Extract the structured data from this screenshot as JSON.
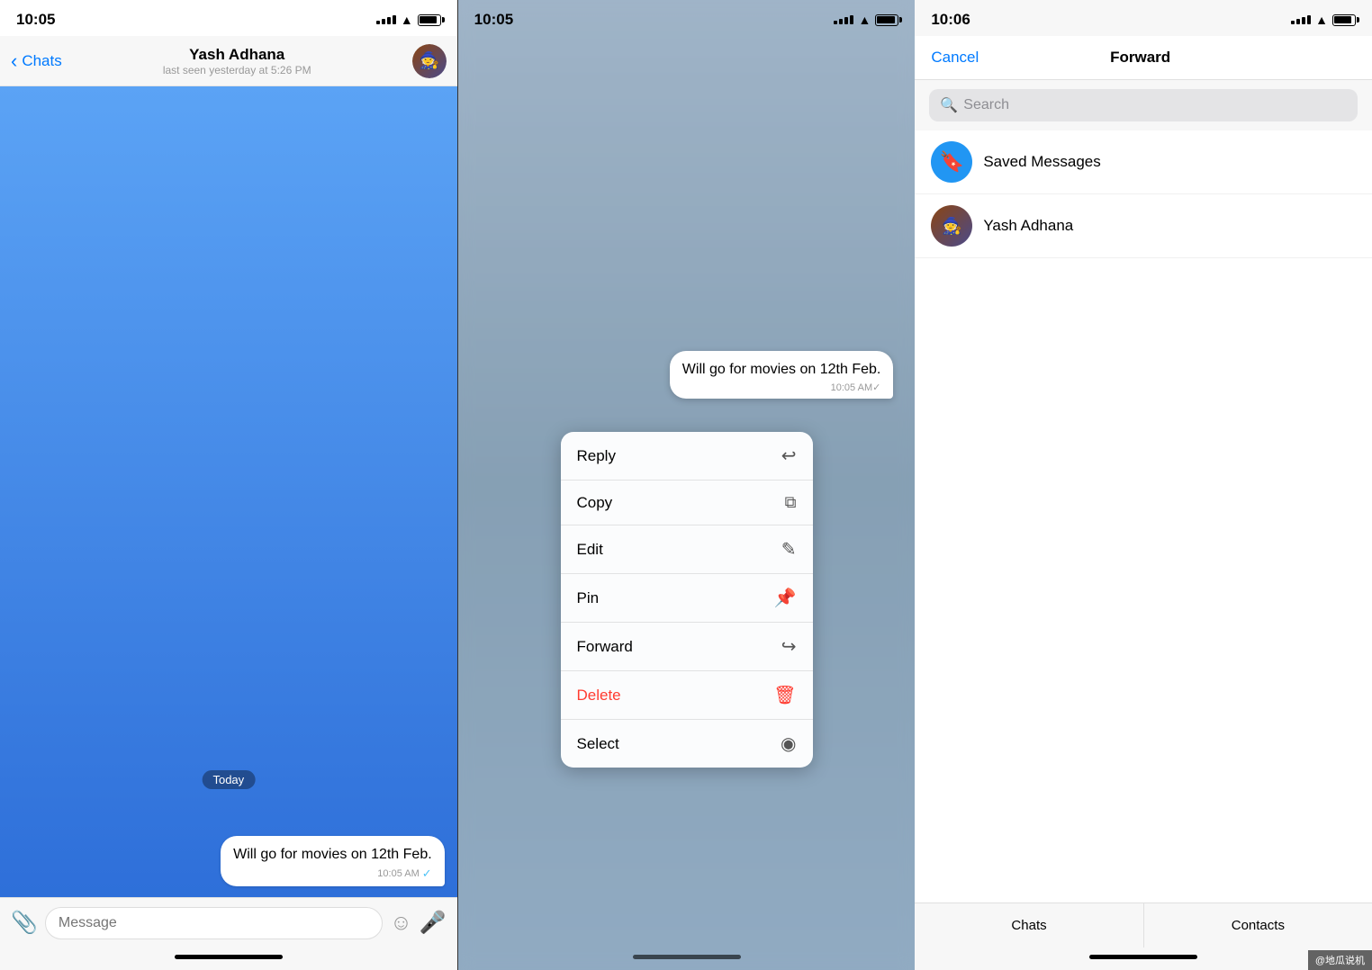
{
  "panel1": {
    "status": {
      "time": "10:05"
    },
    "header": {
      "back_label": "Chats",
      "title": "Yash Adhana",
      "subtitle": "last seen yesterday at 5:26 PM"
    },
    "today_label": "Today",
    "message": {
      "text": "Will go for movies on 12th Feb.",
      "time": "10:05 AM",
      "check": "✓"
    },
    "input": {
      "placeholder": "Message"
    }
  },
  "panel2": {
    "status": {
      "time": "10:05"
    },
    "message": {
      "text": "Will go for movies on 12th Feb.",
      "time": "10:05 AM✓"
    },
    "context_menu": {
      "items": [
        {
          "label": "Reply",
          "icon": "↩",
          "color": "normal"
        },
        {
          "label": "Copy",
          "icon": "⧉",
          "color": "normal"
        },
        {
          "label": "Edit",
          "icon": "✎",
          "color": "normal"
        },
        {
          "label": "Pin",
          "icon": "📌",
          "color": "normal"
        },
        {
          "label": "Forward",
          "icon": "↪",
          "color": "normal"
        },
        {
          "label": "Delete",
          "icon": "🗑",
          "color": "red"
        },
        {
          "label": "Select",
          "icon": "◉",
          "color": "normal"
        }
      ]
    }
  },
  "panel3": {
    "status": {
      "time": "10:06"
    },
    "header": {
      "cancel_label": "Cancel",
      "title": "Forward"
    },
    "search": {
      "placeholder": "Search"
    },
    "contacts": [
      {
        "name": "Saved Messages",
        "type": "saved"
      },
      {
        "name": "Yash Adhana",
        "type": "user"
      }
    ],
    "tabs": [
      {
        "label": "Chats"
      },
      {
        "label": "Contacts"
      }
    ]
  },
  "watermark": "@地瓜说机"
}
